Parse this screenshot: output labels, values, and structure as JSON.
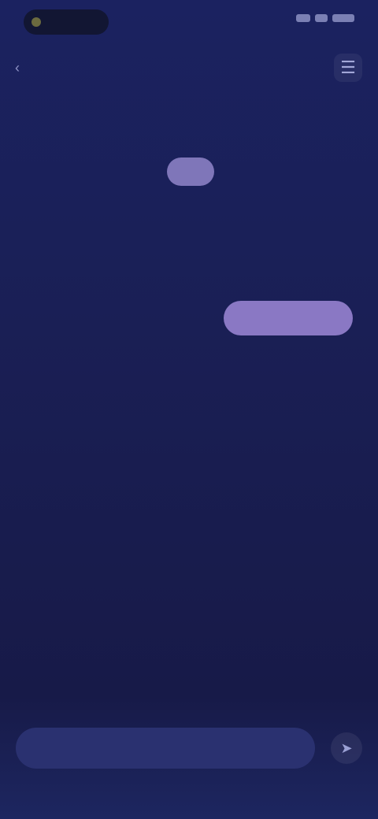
{
  "status_bar": {
    "time": "",
    "icons": [
      "signal-icon",
      "wifi-icon",
      "battery-icon"
    ]
  },
  "topbar": {
    "back_icon": "back-icon",
    "menu_icon": "menu-icon"
  },
  "page": {
    "title": ""
  },
  "chat": {
    "bot_avatar_label": "",
    "bot_sender": "",
    "bot_message": "",
    "user_bubble_text": ""
  },
  "composer": {
    "placeholder": "",
    "send_icon": "send-icon"
  },
  "colors": {
    "background": "#1a1f55",
    "accent": "#8a78c4",
    "input_bg": "#2a3170"
  }
}
